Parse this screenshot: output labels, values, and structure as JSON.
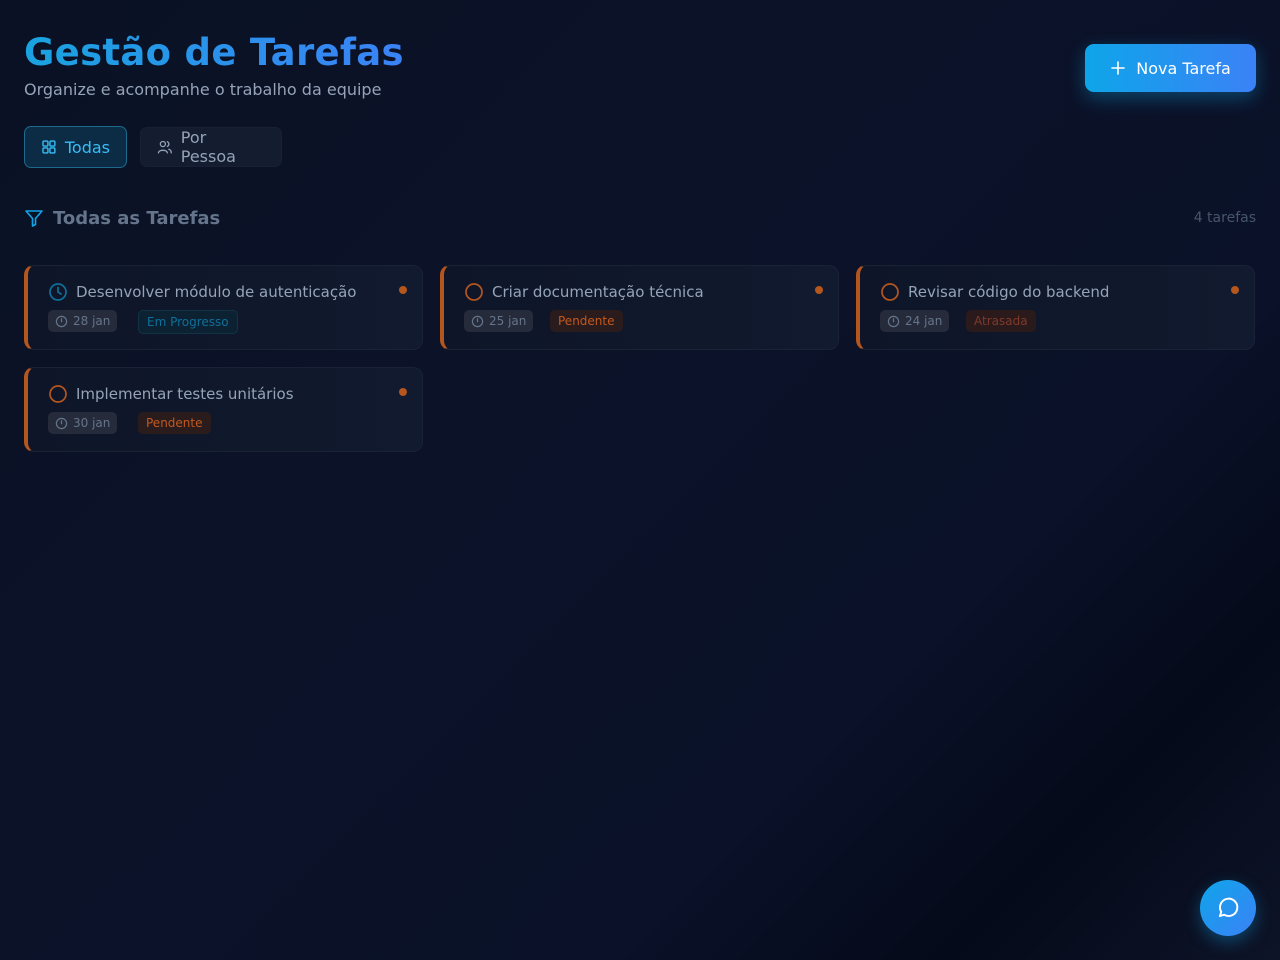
{
  "header": {
    "title": "Gestão de Tarefas",
    "subtitle": "Organize e acompanhe o trabalho da equipe",
    "new_task_label": "Nova Tarefa"
  },
  "tabs": [
    {
      "label": "Todas",
      "icon": "grid-icon",
      "active": true
    },
    {
      "label": "Por Pessoa",
      "icon": "users-icon",
      "active": false
    }
  ],
  "section": {
    "title": "Todas as Tarefas",
    "count": "4 tarefas",
    "icon": "filter-icon"
  },
  "tasks": [
    {
      "title": "Desenvolver módulo de autenticação",
      "date": "28 jan",
      "status": "Em Progresso",
      "status_icon": "clock-icon"
    },
    {
      "title": "Criar documentação técnica",
      "date": "25 jan",
      "status": "Pendente",
      "status_icon": "circle-icon"
    },
    {
      "title": "Revisar código do backend",
      "date": "24 jan",
      "status": "Atrasada",
      "status_icon": "circle-icon"
    },
    {
      "title": "Implementar testes unitários",
      "date": "30 jan",
      "status": "Pendente",
      "status_icon": "circle-icon"
    }
  ],
  "colors": {
    "accent": "#0ea5e9",
    "accent_blue": "#3b82f6",
    "priority": "#b4561e",
    "background": "#0b1226"
  },
  "chat": {
    "icon": "chat-icon"
  }
}
